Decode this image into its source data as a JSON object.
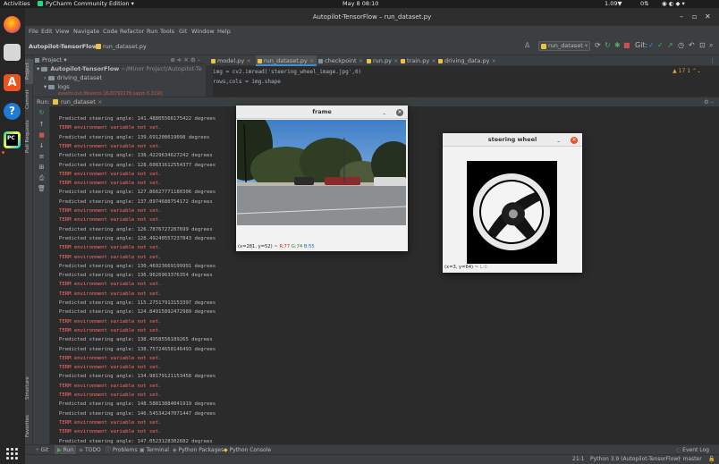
{
  "topbar": {
    "activities": "Activities",
    "app_name": "PyCharm Community Edition",
    "datetime": "May 8  08:10",
    "battery": "1.09",
    "net": "0"
  },
  "window": {
    "title": "Autopilot-TensorFlow – run_dataset.py"
  },
  "menu": [
    "File",
    "Edit",
    "View",
    "Navigate",
    "Code",
    "Refactor",
    "Run",
    "Tools",
    "Git",
    "Window",
    "Help"
  ],
  "breadcrumb": {
    "project": "Autopilot-TensorFlow",
    "file": "run_dataset.py"
  },
  "run_config": "run_dataset",
  "git_label": "Git:",
  "project_panel": {
    "header": "Project",
    "root": "Autopilot-TensorFlow",
    "root_path": "~/Minor Project/Autopilot-Te",
    "items": [
      "driving_dataset",
      "logs",
      "events.out.tfevents.1620792176.saptc-5.3190"
    ]
  },
  "editor_tabs": [
    "model.py",
    "run_dataset.py",
    "checkpoint",
    "run.py",
    "train.py",
    "driving_data.py"
  ],
  "editor_lines": [
    "img = cv2.imread('steering_wheel_image.jpg',0)",
    "rows,cols = img.shape"
  ],
  "inspection": "17  1",
  "run_panel": {
    "label": "Run:",
    "tab": "run_dataset"
  },
  "console": [
    {
      "t": "Predicted steering angle: 141.48805566175422 degrees",
      "k": "out"
    },
    {
      "t": "TERM environment variable not set.",
      "k": "err"
    },
    {
      "t": "Predicted steering angle: 139.691208619098 degrees",
      "k": "out"
    },
    {
      "t": "TERM environment variable not set.",
      "k": "err"
    },
    {
      "t": "Predicted steering angle: 138.4229634627242 degrees",
      "k": "out"
    },
    {
      "t": "Predicted steering angle: 128.60831612554377 degrees",
      "k": "out"
    },
    {
      "t": "TERM environment variable not set.",
      "k": "err"
    },
    {
      "t": "TERM environment variable not set.",
      "k": "err"
    },
    {
      "t": "Predicted steering angle: 127.86627771180306 degrees",
      "k": "out"
    },
    {
      "t": "Predicted steering angle: 137.0974688754172 degrees",
      "k": "out"
    },
    {
      "t": "TERM environment variable not set.",
      "k": "err"
    },
    {
      "t": "TERM environment variable not set.",
      "k": "err"
    },
    {
      "t": "Predicted steering angle: 126.7876727207699 degrees",
      "k": "out"
    },
    {
      "t": "Predicted steering angle: 128.49240557237843 degrees",
      "k": "out"
    },
    {
      "t": "TERM environment variable not set.",
      "k": "err"
    },
    {
      "t": "TERM environment variable not set.",
      "k": "err"
    },
    {
      "t": "Predicted steering angle: 130.46923669199991 degrees",
      "k": "out"
    },
    {
      "t": "Predicted steering angle: 136.9626963376354 degrees",
      "k": "out"
    },
    {
      "t": "TERM environment variable not set.",
      "k": "err"
    },
    {
      "t": "TERM environment variable not set.",
      "k": "err"
    },
    {
      "t": "Predicted steering angle: 115.27517913153397 degrees",
      "k": "out"
    },
    {
      "t": "Predicted steering angle: 124.84915892472989 degrees",
      "k": "out"
    },
    {
      "t": "TERM environment variable not set.",
      "k": "err"
    },
    {
      "t": "TERM environment variable not set.",
      "k": "err"
    },
    {
      "t": "Predicted steering angle: 138.4958556189265 degrees",
      "k": "out"
    },
    {
      "t": "Predicted steering angle: 138.75724658146493 degrees",
      "k": "out"
    },
    {
      "t": "TERM environment variable not set.",
      "k": "err"
    },
    {
      "t": "TERM environment variable not set.",
      "k": "err"
    },
    {
      "t": "Predicted steering angle: 134.98179121153458 degrees",
      "k": "out"
    },
    {
      "t": "TERM environment variable not set.",
      "k": "err"
    },
    {
      "t": "TERM environment variable not set.",
      "k": "err"
    },
    {
      "t": "Predicted steering angle: 148.58813884041919 degrees",
      "k": "out"
    },
    {
      "t": "Predicted steering angle: 146.54534247071447 degrees",
      "k": "out"
    },
    {
      "t": "TERM environment variable not set.",
      "k": "err"
    },
    {
      "t": "TERM environment variable not set.",
      "k": "err"
    },
    {
      "t": "Predicted steering angle: 147.0523128302682 degrees",
      "k": "out"
    }
  ],
  "bottom_tabs": [
    "Git",
    "Run",
    "TODO",
    "Problems",
    "Terminal",
    "Python Packages",
    "Python Console",
    "Event Log"
  ],
  "side_tabs": [
    "Project",
    "Commit",
    "Pull Requests",
    "Structure",
    "Favorites"
  ],
  "status": {
    "position": "21:1",
    "interpreter": "Python 3.9 (Autopilot-TensorFlow)",
    "branch": "master"
  },
  "frame_window": {
    "title": "frame",
    "coord": "(x=281, y=52) ~",
    "r": "R:77",
    "g": "G:74",
    "b": "B:55"
  },
  "wheel_window": {
    "title": "steering wheel",
    "coord": "(x=3, y=64) ~",
    "l": "L:0"
  },
  "colors": {
    "accent": "#4a88c7",
    "error": "#ff6b68",
    "window_close": "#e95420"
  }
}
